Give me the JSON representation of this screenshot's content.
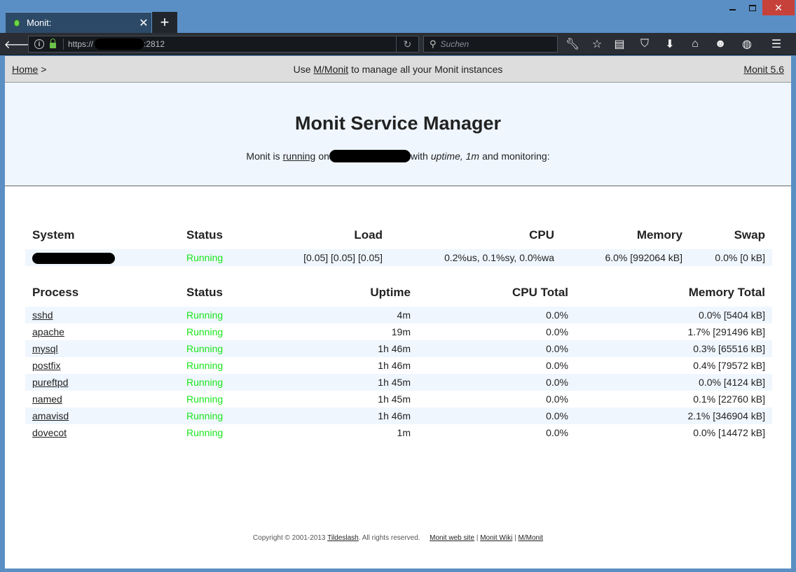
{
  "browser": {
    "tab_title": "Monit:",
    "new_tab": "+",
    "url_prefix": "https://",
    "url_suffix": ":2812",
    "search_placeholder": "Suchen",
    "icons": [
      "back-arrow-icon",
      "info-icon",
      "lock-icon",
      "reload-icon",
      "search-icon",
      "wrench-icon",
      "star-icon",
      "reading-list-icon",
      "pocket-icon",
      "download-icon",
      "home-icon",
      "smiley-icon",
      "globe-icon",
      "hamburger-menu-icon"
    ]
  },
  "breadcrumb": {
    "home": "Home",
    "separator": ">",
    "center_prefix": "Use",
    "center_link": "M/Monit",
    "center_suffix": "to manage all your Monit instances",
    "version_link": "Monit 5.6"
  },
  "header": {
    "title": "Monit Service Manager",
    "status_prefix": "Monit is",
    "status_link": "running",
    "status_on": "on",
    "status_with": "with",
    "uptime_text": "uptime, 1m",
    "status_suffix": "and monitoring:"
  },
  "system_table": {
    "headers": [
      "System",
      "Status",
      "Load",
      "CPU",
      "Memory",
      "Swap"
    ],
    "row": {
      "status": "Running",
      "load": "[0.05] [0.05] [0.05]",
      "cpu": "0.2%us, 0.1%sy, 0.0%wa",
      "memory": "6.0% [992064 kB]",
      "swap": "0.0% [0 kB]"
    }
  },
  "process_table": {
    "headers": [
      "Process",
      "Status",
      "Uptime",
      "CPU Total",
      "Memory Total"
    ],
    "rows": [
      {
        "name": "sshd",
        "status": "Running",
        "uptime": "4m",
        "cpu": "0.0%",
        "memory": "0.0% [5404 kB]"
      },
      {
        "name": "apache",
        "status": "Running",
        "uptime": "19m",
        "cpu": "0.0%",
        "memory": "1.7% [291496 kB]"
      },
      {
        "name": "mysql",
        "status": "Running",
        "uptime": "1h 46m",
        "cpu": "0.0%",
        "memory": "0.3% [65516 kB]"
      },
      {
        "name": "postfix",
        "status": "Running",
        "uptime": "1h 46m",
        "cpu": "0.0%",
        "memory": "0.4% [79572 kB]"
      },
      {
        "name": "pureftpd",
        "status": "Running",
        "uptime": "1h 45m",
        "cpu": "0.0%",
        "memory": "0.0% [4124 kB]"
      },
      {
        "name": "named",
        "status": "Running",
        "uptime": "1h 45m",
        "cpu": "0.0%",
        "memory": "0.1% [22760 kB]"
      },
      {
        "name": "amavisd",
        "status": "Running",
        "uptime": "1h 46m",
        "cpu": "0.0%",
        "memory": "2.1% [346904 kB]"
      },
      {
        "name": "dovecot",
        "status": "Running",
        "uptime": "1m",
        "cpu": "0.0%",
        "memory": "0.0% [14472 kB]"
      }
    ]
  },
  "footer": {
    "copyright": "Copyright © 2001-2013",
    "company_link": "Tildeslash",
    "rights": ". All rights reserved.",
    "links": [
      "Monit web site",
      "Monit Wiki",
      "M/Monit"
    ],
    "link_sep": "|"
  },
  "colors": {
    "running": "#19e51c",
    "header_bg": "#eff6fe",
    "breadcrumb_bg": "#dddddd"
  }
}
